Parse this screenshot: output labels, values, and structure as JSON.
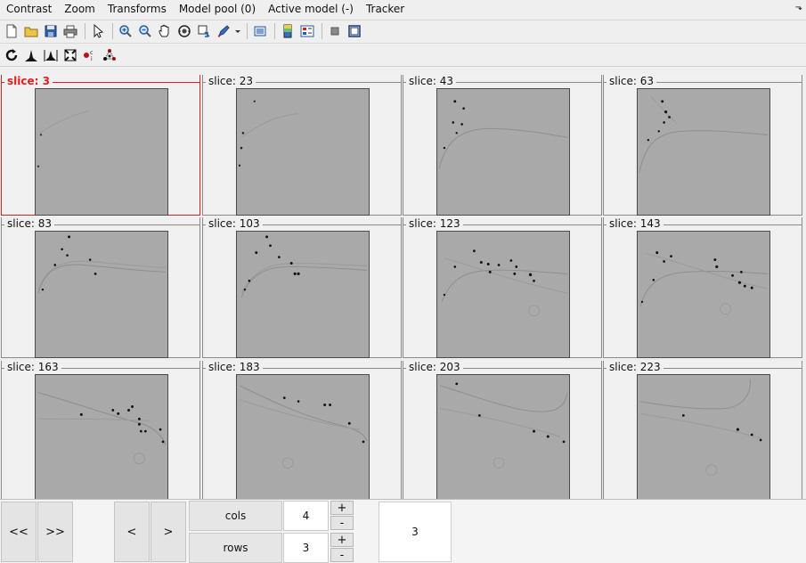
{
  "menu": {
    "items": [
      "Contrast",
      "Zoom",
      "Transforms",
      "Model pool (0)",
      "Active model (-)",
      "Tracker"
    ],
    "corner_glyph": "⬎"
  },
  "toolbar1": {
    "icons": [
      "new-icon",
      "open-icon",
      "save-icon",
      "print-icon",
      "pointer-icon",
      "zoom-in-icon",
      "zoom-out-icon",
      "pan-hand-icon",
      "rotate-view-icon",
      "add-marker-icon",
      "pen-tool-icon",
      "tool-dropdown-icon",
      "snapshot-icon",
      "color-bar-icon",
      "panel-layout-icon",
      "square-icon",
      "frame-icon"
    ]
  },
  "toolbar2": {
    "icons": [
      "refresh-icon",
      "histogram-icon",
      "histogram-range-icon",
      "fit-icon",
      "model-points-icon",
      "molecule-icon"
    ]
  },
  "grid": {
    "cells": [
      {
        "label": "slice: 3",
        "active": true
      },
      {
        "label": "slice: 23",
        "active": false
      },
      {
        "label": "slice: 43",
        "active": false
      },
      {
        "label": "slice: 63",
        "active": false
      },
      {
        "label": "slice: 83",
        "active": false
      },
      {
        "label": "slice: 103",
        "active": false
      },
      {
        "label": "slice: 123",
        "active": false
      },
      {
        "label": "slice: 143",
        "active": false
      },
      {
        "label": "slice: 163",
        "active": false
      },
      {
        "label": "slice: 183",
        "active": false
      },
      {
        "label": "slice: 203",
        "active": false
      },
      {
        "label": "slice: 223",
        "active": false
      }
    ]
  },
  "controls": {
    "first_label": "<<",
    "last_label": ">>",
    "prev_label": "<",
    "next_label": ">",
    "cols_label": "cols",
    "cols_value": "4",
    "rows_label": "rows",
    "rows_value": "3",
    "plus_label": "+",
    "minus_label": "-",
    "current_slice": "3"
  }
}
